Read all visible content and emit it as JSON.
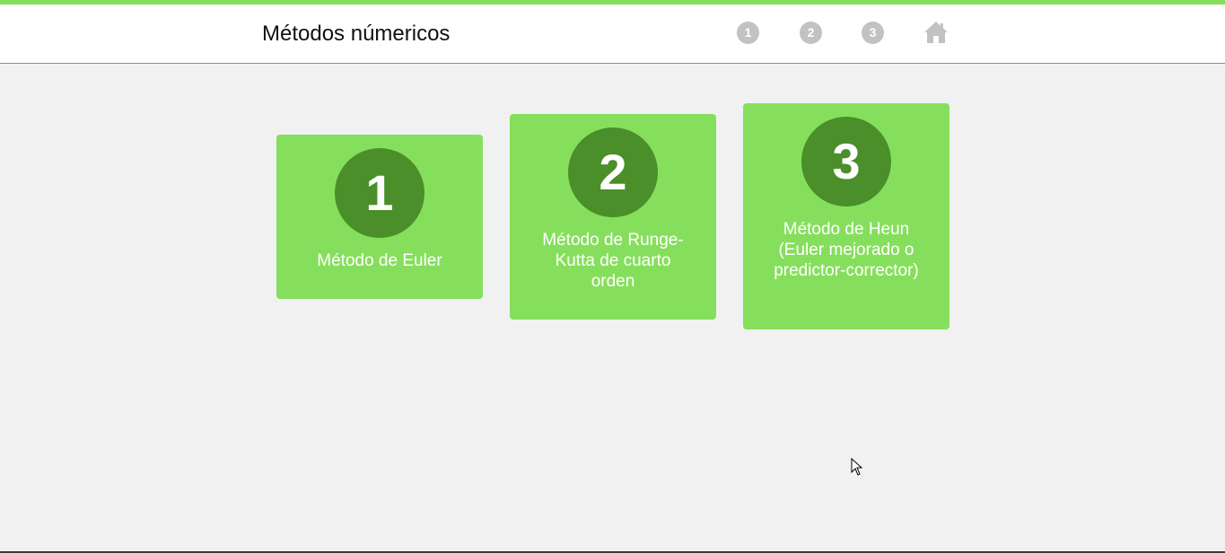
{
  "header": {
    "title": "Métodos númericos",
    "nav": [
      {
        "label": "1"
      },
      {
        "label": "2"
      },
      {
        "label": "3"
      }
    ],
    "home_icon": "home-icon"
  },
  "cards": [
    {
      "number": "1",
      "label": "Método de Euler"
    },
    {
      "number": "2",
      "label": "Método de Runge-Kutta de cuarto orden"
    },
    {
      "number": "3",
      "label": "Método de Heun (Euler mejorado o predictor-corrector)"
    }
  ],
  "colors": {
    "accent": "#86df5c",
    "card_bg": "#86df5c",
    "circle_bg": "#4a8f29",
    "nav_circle": "#c2c2c2",
    "page_bg": "#f1f1f1"
  }
}
